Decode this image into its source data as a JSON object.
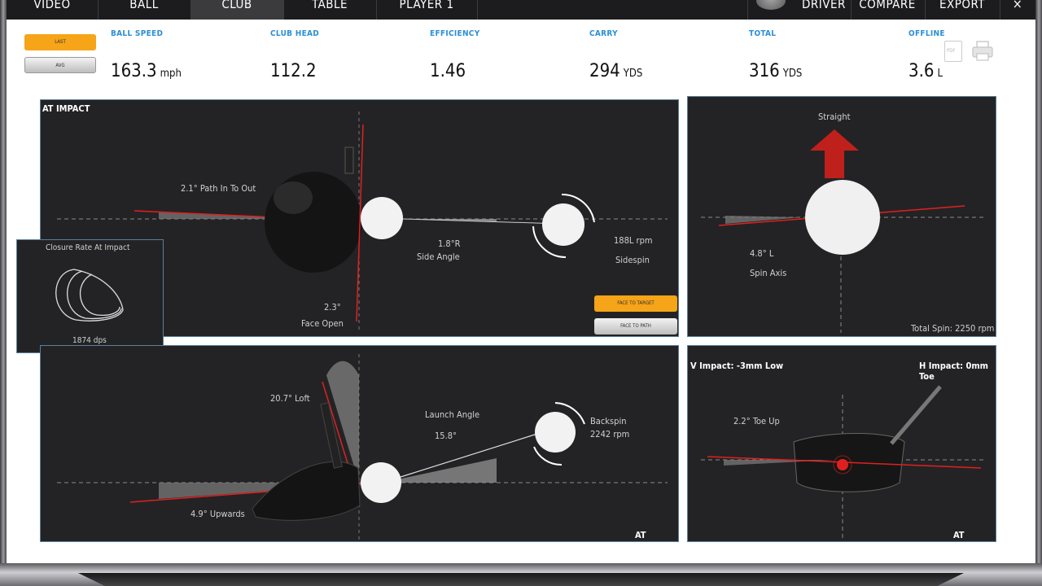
{
  "nav": {
    "tabs": [
      "VIDEO",
      "BALL",
      "CLUB",
      "TABLE",
      "PLAYER 1"
    ],
    "active_tab": "CLUB",
    "club": "DRIVER",
    "compare": "COMPARE",
    "export": "EXPORT",
    "close_icon": "close-icon",
    "club_icon": "driver-head-icon"
  },
  "toggle": {
    "last": "LAST",
    "avg": "AVG",
    "active": "LAST",
    "accent": "#f6a418"
  },
  "metrics": [
    {
      "label": "BALL SPEED",
      "value": "163.3",
      "unit": "mph"
    },
    {
      "label": "CLUB HEAD",
      "value": "112.2",
      "unit": ""
    },
    {
      "label": "EFFICIENCY",
      "value": "1.46",
      "unit": ""
    },
    {
      "label": "CARRY",
      "value": "294",
      "unit": "YDS"
    },
    {
      "label": "TOTAL",
      "value": "316",
      "unit": "YDS"
    },
    {
      "label": "OFFLINE",
      "value": "3.6",
      "unit": "L"
    }
  ],
  "actions": {
    "pdf": "PDF",
    "pdf_icon": "pdf-icon",
    "print_icon": "printer-icon"
  },
  "impact_top": {
    "title": "AT IMPACT",
    "path": "2.1° Path In To Out",
    "side_angle_value": "1.8°R",
    "side_angle_label": "Side Angle",
    "sidespin_value": "188L rpm",
    "sidespin_label": "Sidespin",
    "face_value": "2.3°",
    "face_label": "Face Open",
    "face_to_target": "FACE TO TARGET",
    "face_to_path": "FACE TO PATH"
  },
  "closure": {
    "title": "Closure Rate At Impact",
    "value": "1874 dps"
  },
  "spin_axis": {
    "direction": "Straight",
    "value": "4.8° L",
    "label": "Spin Axis",
    "total_spin": "Total Spin: 2250 rpm"
  },
  "launch": {
    "loft": "20.7° Loft",
    "launch_label": "Launch Angle",
    "launch_value": "15.8°",
    "backspin_label": "Backspin",
    "backspin_value": "2242 rpm",
    "attack": "4.9° Upwards",
    "title": "AT IMPACT"
  },
  "impact_location": {
    "v_impact": "V Impact: -3mm Low",
    "h_impact": "H Impact: 0mm Toe",
    "toe": "2.2° Toe Up",
    "title": "AT IMPACT"
  },
  "colors": {
    "panel_bg": "#232325",
    "label_blue": "#2a8fd6",
    "red": "#e02020",
    "amber": "#f6a418"
  }
}
